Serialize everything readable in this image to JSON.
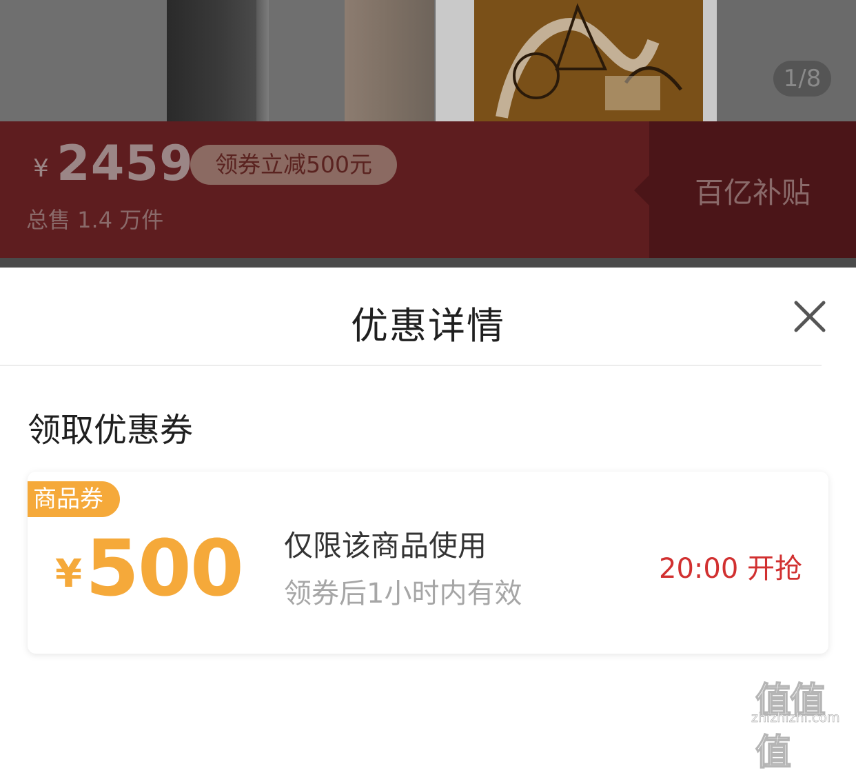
{
  "gallery": {
    "page_indicator": "1/8"
  },
  "price_banner": {
    "currency": "¥",
    "price": "2459",
    "coupon_badge": "领券立减500元",
    "total_sold": "总售 1.4 万件",
    "subsidy_label": "百亿补贴"
  },
  "sheet": {
    "title": "优惠详情",
    "section_title": "领取优惠券"
  },
  "coupon": {
    "tag": "商品券",
    "currency": "¥",
    "amount": "500",
    "description": "仅限该商品使用",
    "validity": "领券后1小时内有效",
    "action": "20:00 开抢"
  },
  "watermark": {
    "glyphs": "值值值",
    "domain": "zhizhizhi.com"
  },
  "colors": {
    "accent_orange": "#f5a93a",
    "action_red": "#d13030",
    "banner_dim_red": "#5e1d1f"
  },
  "icons": {
    "close": "close-icon"
  }
}
